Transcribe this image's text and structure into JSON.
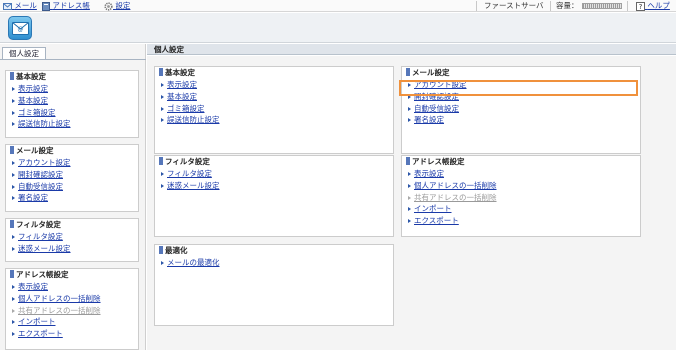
{
  "topbar": {
    "mail": "メール",
    "addressbook": "アドレス帳",
    "settings": "設定",
    "server": "ファーストサーバ",
    "quota_label": "容量：",
    "help": "ヘルプ"
  },
  "sidebar": {
    "tab": "個人設定",
    "sections": [
      {
        "title": "基本設定",
        "links": [
          "表示設定",
          "基本設定",
          "ゴミ箱設定",
          "誤送信防止設定"
        ]
      },
      {
        "title": "メール設定",
        "links": [
          "アカウント設定",
          "開封確認設定",
          "自動受信設定",
          "署名設定"
        ]
      },
      {
        "title": "フィルタ設定",
        "links": [
          "フィルタ設定",
          "迷惑メール設定"
        ]
      },
      {
        "title": "アドレス帳設定",
        "links": [
          "表示設定",
          "個人アドレスの一括削除",
          "共有アドレスの一括削除",
          "インポート",
          "エクスポート"
        ]
      }
    ]
  },
  "main": {
    "title": "個人設定",
    "boxes": [
      {
        "title": "基本設定",
        "links": [
          "表示設定",
          "基本設定",
          "ゴミ箱設定",
          "誤送信防止設定"
        ]
      },
      {
        "title": "メール設定",
        "links": [
          "アカウント設定",
          "開封確認設定",
          "自動受信設定",
          "署名設定"
        ]
      },
      {
        "title": "フィルタ設定",
        "links": [
          "フィルタ設定",
          "迷惑メール設定"
        ]
      },
      {
        "title": "アドレス帳設定",
        "links": [
          "表示設定",
          "個人アドレスの一括削除",
          "共有アドレスの一括削除",
          "インポート",
          "エクスポート"
        ]
      },
      {
        "title": "最適化",
        "links": [
          "メールの最適化"
        ]
      }
    ]
  },
  "colors": {
    "link": "#1a3aa8",
    "disabled_link": "#9a9a9a",
    "highlight": "#f0913c"
  },
  "disabled_items": [
    "共有アドレスの一括削除"
  ]
}
